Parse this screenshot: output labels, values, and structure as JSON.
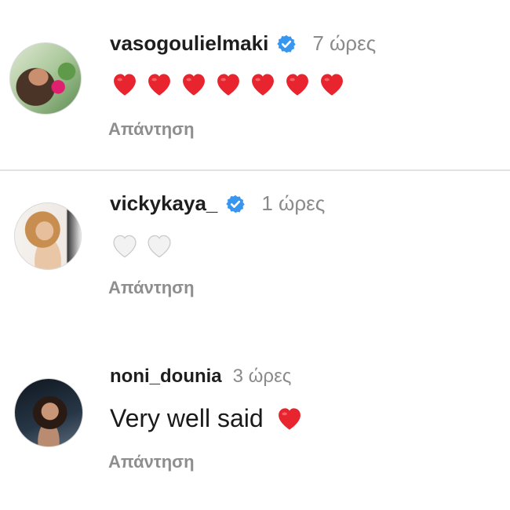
{
  "comments": [
    {
      "username": "vasogoulielmaki",
      "verified": true,
      "time": "7 ώρες",
      "hearts": {
        "count": 7,
        "color": "#e8242e"
      },
      "text": "",
      "reply_label": "Απάντηση"
    },
    {
      "username": "vickykaya_",
      "verified": true,
      "time": "1 ώρες",
      "hearts": {
        "count": 2,
        "color": "#f2f2f2"
      },
      "text": "",
      "reply_label": "Απάντηση"
    },
    {
      "username": "noni_dounia",
      "verified": false,
      "time": "3 ώρες",
      "hearts": {
        "count": 1,
        "color": "#e8242e"
      },
      "text": "Very well said",
      "reply_label": "Απάντηση"
    }
  ],
  "colors": {
    "username": "#1e1e1e",
    "meta": "#8a8a8a",
    "verified_badge": "#3797f0",
    "divider": "#e2e2e2"
  },
  "icons": {
    "verified": "verified-badge-icon",
    "heart": "heart-icon"
  }
}
